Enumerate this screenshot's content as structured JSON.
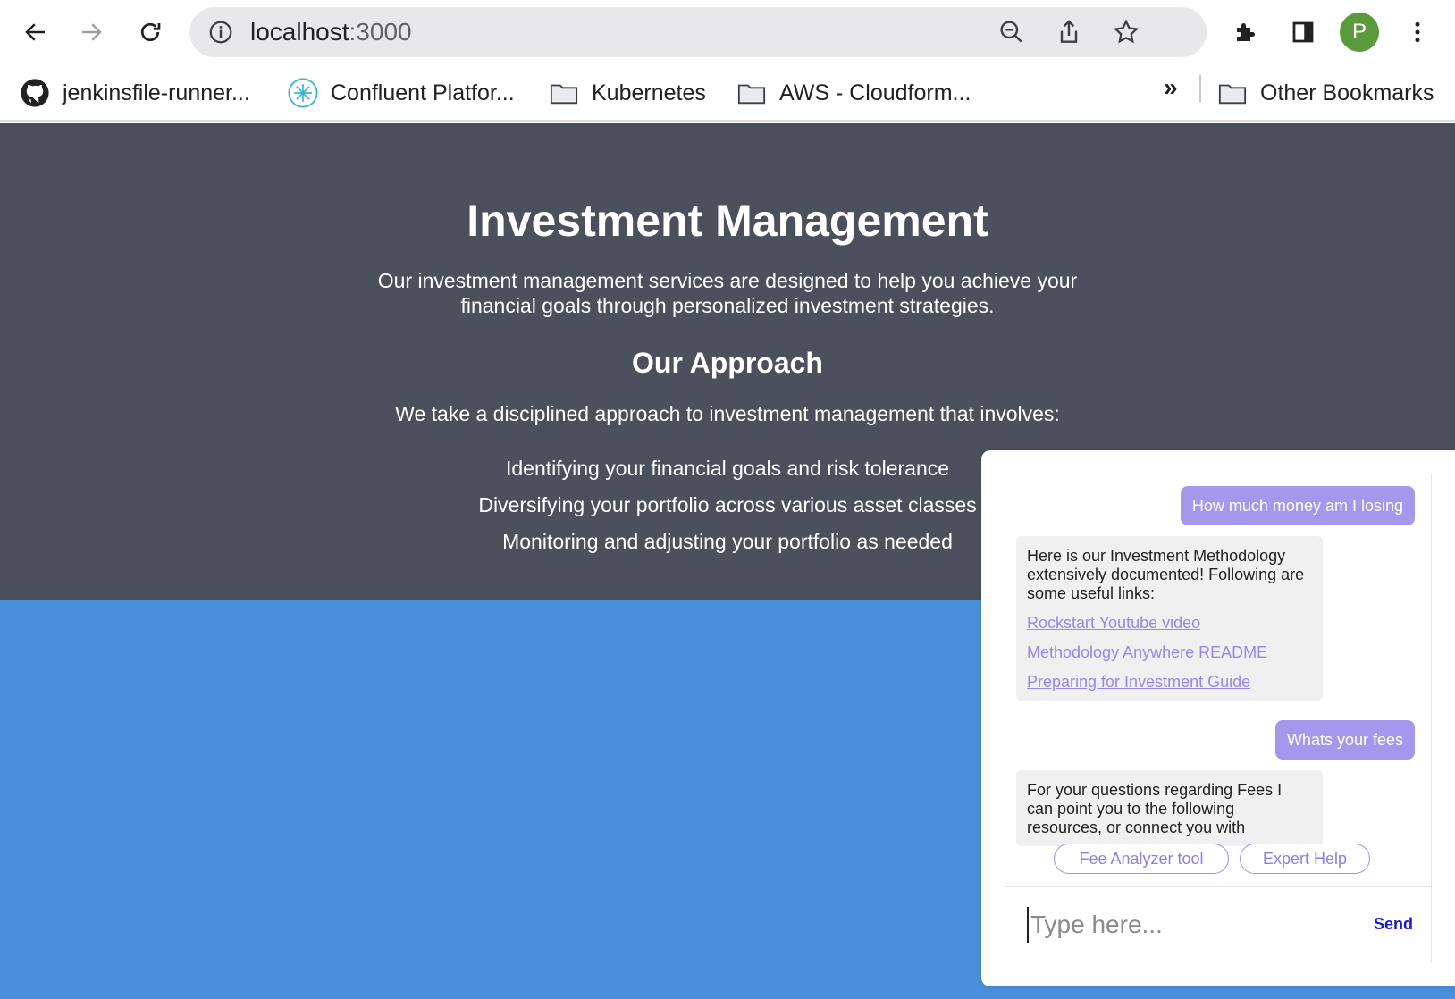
{
  "browser": {
    "url_host": "localhost",
    "url_port": ":3000",
    "profile_initial": "P",
    "bookmarks": [
      {
        "label": "jenkinsfile-runner...",
        "icon": "github-icon"
      },
      {
        "label": "Confluent Platfor...",
        "icon": "confluent-icon"
      },
      {
        "label": "Kubernetes",
        "icon": "folder-icon"
      },
      {
        "label": "AWS - Cloudform...",
        "icon": "folder-icon"
      }
    ],
    "overflow_label": "»",
    "other_bookmarks": "Other Bookmarks"
  },
  "page": {
    "title": "Investment Management",
    "description": "Our investment management services are designed to help you achieve your financial goals through personalized investment strategies.",
    "approach_heading": "Our Approach",
    "approach_intro": "We take a disciplined approach to investment management that involves:",
    "approach_items": [
      "Identifying your financial goals and risk tolerance",
      "Diversifying your portfolio across various asset classes",
      "Monitoring and adjusting your portfolio as needed"
    ]
  },
  "chat": {
    "messages": [
      {
        "from": "user",
        "text": "How much money am I losing"
      },
      {
        "from": "bot",
        "text": "Here is our Investment Methodology extensively documented! Following are some useful links:",
        "links": [
          "Rockstart Youtube video",
          "Methodology Anywhere README",
          "Preparing for Investment Guide"
        ]
      },
      {
        "from": "user",
        "text": "Whats your fees"
      },
      {
        "from": "bot",
        "text": "For your questions regarding Fees I can point you to the following resources, or connect you with"
      }
    ],
    "quick_replies": [
      "Fee Analyzer tool",
      "Expert Help"
    ],
    "input_placeholder": "Type here...",
    "input_value": "",
    "send_label": "Send"
  },
  "colors": {
    "hero_bg": "#4a515c",
    "page_bg": "#4a90dd",
    "user_bubble": "#a598ec",
    "bot_bubble": "#f0f0f0",
    "link": "#9588e6",
    "send": "#1a1ad6"
  }
}
